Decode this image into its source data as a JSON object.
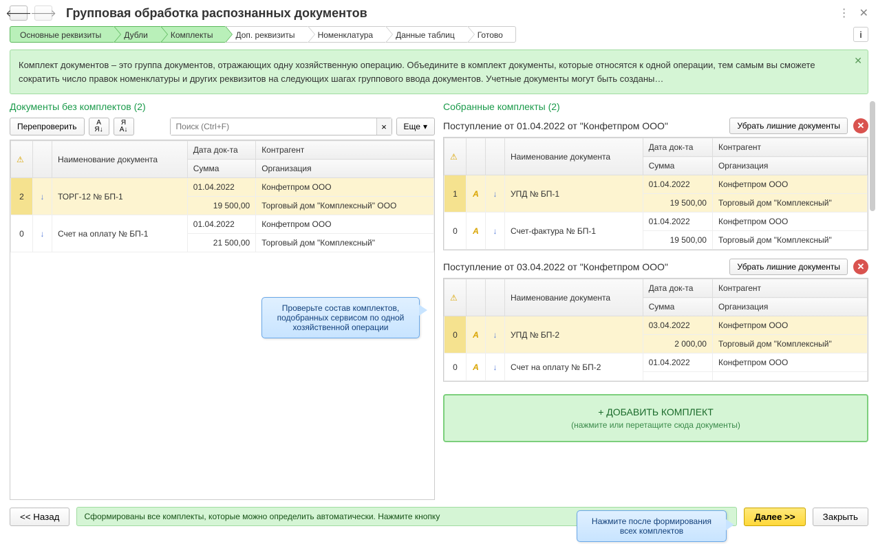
{
  "header": {
    "title": "Групповая обработка распознанных документов"
  },
  "steps": [
    "Основные реквизиты",
    "Дубли",
    "Комплекты",
    "Доп. реквизиты",
    "Номенклатура",
    "Данные таблиц",
    "Готово"
  ],
  "active_steps": [
    0,
    1,
    2
  ],
  "banner": "Комплект документов – это группа документов, отражающих одну хозяйственную операцию. Объедините в комплект документы, которые относятся к одной операции, тем самым вы сможете сократить число правок номенклатуры и других реквизитов на следующих шагах группового ввода документов. Учетные документы могут быть созданы…",
  "left": {
    "title": "Документы без комплектов (2)",
    "recheck": "Перепроверить",
    "search_placeholder": "Поиск (Ctrl+F)",
    "more": "Еще",
    "headers": {
      "name": "Наименование документа",
      "date": "Дата док-та",
      "contr": "Контрагент",
      "sum": "Сумма",
      "org": "Организация"
    },
    "rows": [
      {
        "num": "2",
        "highlight": true,
        "name": "ТОРГ-12 № БП-1",
        "date": "01.04.2022",
        "contr": "Конфетпром ООО",
        "sum": "19 500,00",
        "org": "Торговый дом \"Комплексный\" ООО"
      },
      {
        "num": "0",
        "highlight": false,
        "name": "Счет на оплату № БП-1",
        "date": "01.04.2022",
        "contr": "Конфетпром ООО",
        "sum": "21 500,00",
        "org": "Торговый дом \"Комплексный\""
      }
    ]
  },
  "right": {
    "title": "Собранные комплекты (2)",
    "remove_label": "Убрать лишние документы",
    "headers": {
      "name": "Наименование документа",
      "date": "Дата док-та",
      "contr": "Контрагент",
      "sum": "Сумма",
      "org": "Организация"
    },
    "kits": [
      {
        "title": "Поступление от 01.04.2022 от \"Конфетпром ООО\"",
        "rows": [
          {
            "num": "1",
            "highlight": true,
            "name": "УПД № БП-1",
            "date": "01.04.2022",
            "contr": "Конфетпром ООО",
            "sum": "19 500,00",
            "org": "Торговый дом \"Комплексный\""
          },
          {
            "num": "0",
            "highlight": false,
            "name": "Счет-фактура № БП-1",
            "date": "01.04.2022",
            "contr": "Конфетпром ООО",
            "sum": "19 500,00",
            "org": "Торговый дом \"Комплексный\""
          }
        ]
      },
      {
        "title": "Поступление от 03.04.2022 от \"Конфетпром ООО\"",
        "rows": [
          {
            "num": "0",
            "highlight": true,
            "name": "УПД № БП-2",
            "date": "03.04.2022",
            "contr": "Конфетпром ООО",
            "sum": "2 000,00",
            "org": "Торговый дом \"Комплексный\""
          },
          {
            "num": "0",
            "highlight": false,
            "name": "Счет на оплату № БП-2",
            "date": "01.04.2022",
            "contr": "Конфетпром ООО",
            "sum": "",
            "org": ""
          }
        ]
      }
    ],
    "add_kit_title": "+ ДОБАВИТЬ КОМПЛЕКТ",
    "add_kit_sub": "(нажмите или перетащите сюда документы)"
  },
  "callouts": {
    "c1": "Проверьте состав комплектов, подобранных сервисом по одной хозяйственной операции",
    "c2": "Нажмите после формирования всех комплектов"
  },
  "footer": {
    "back": "<< Назад",
    "status": "Сформированы все комплекты, которые можно определить автоматически. Нажмите кнопку",
    "next": "Далее >>",
    "close": "Закрыть"
  }
}
